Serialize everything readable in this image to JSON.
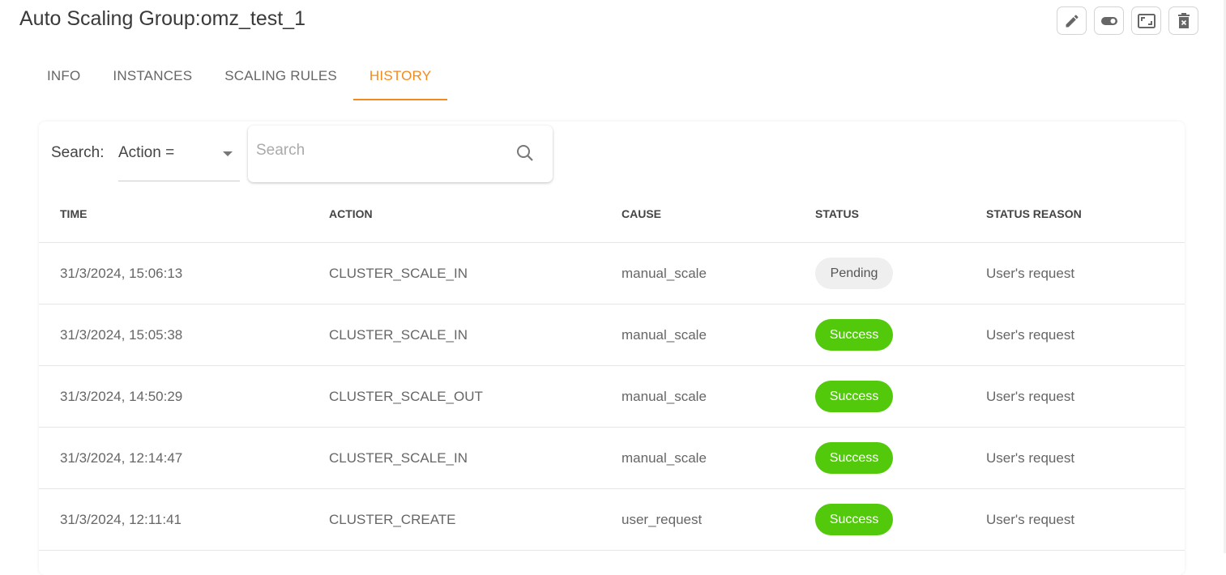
{
  "title": "Auto Scaling Group:omz_test_1",
  "actions": [
    {
      "icon": "pencil-icon"
    },
    {
      "icon": "toggle-icon"
    },
    {
      "icon": "resize-icon"
    },
    {
      "icon": "trash-icon"
    }
  ],
  "tabs": [
    {
      "label": "INFO"
    },
    {
      "label": "INSTANCES"
    },
    {
      "label": "SCALING RULES"
    },
    {
      "label": "HISTORY",
      "active": true
    }
  ],
  "accent": "#f28a1e",
  "search": {
    "label": "Search:",
    "filter": "Action =",
    "placeholder": "Search"
  },
  "table": {
    "columns": [
      "TIME",
      "ACTION",
      "CAUSE",
      "STATUS",
      "STATUS REASON"
    ],
    "rows": [
      {
        "time": "31/3/2024, 15:06:13",
        "action": "CLUSTER_SCALE_IN",
        "cause": "manual_scale",
        "status": "Pending",
        "reason": "User's request"
      },
      {
        "time": "31/3/2024, 15:05:38",
        "action": "CLUSTER_SCALE_IN",
        "cause": "manual_scale",
        "status": "Success",
        "reason": "User's request"
      },
      {
        "time": "31/3/2024, 14:50:29",
        "action": "CLUSTER_SCALE_OUT",
        "cause": "manual_scale",
        "status": "Success",
        "reason": "User's request"
      },
      {
        "time": "31/3/2024, 12:14:47",
        "action": "CLUSTER_SCALE_IN",
        "cause": "manual_scale",
        "status": "Success",
        "reason": "User's request"
      },
      {
        "time": "31/3/2024, 12:11:41",
        "action": "CLUSTER_CREATE",
        "cause": "user_request",
        "status": "Success",
        "reason": "User's request"
      }
    ]
  },
  "status_colors": {
    "Pending": "#efefef",
    "Success": "#52c90a"
  }
}
